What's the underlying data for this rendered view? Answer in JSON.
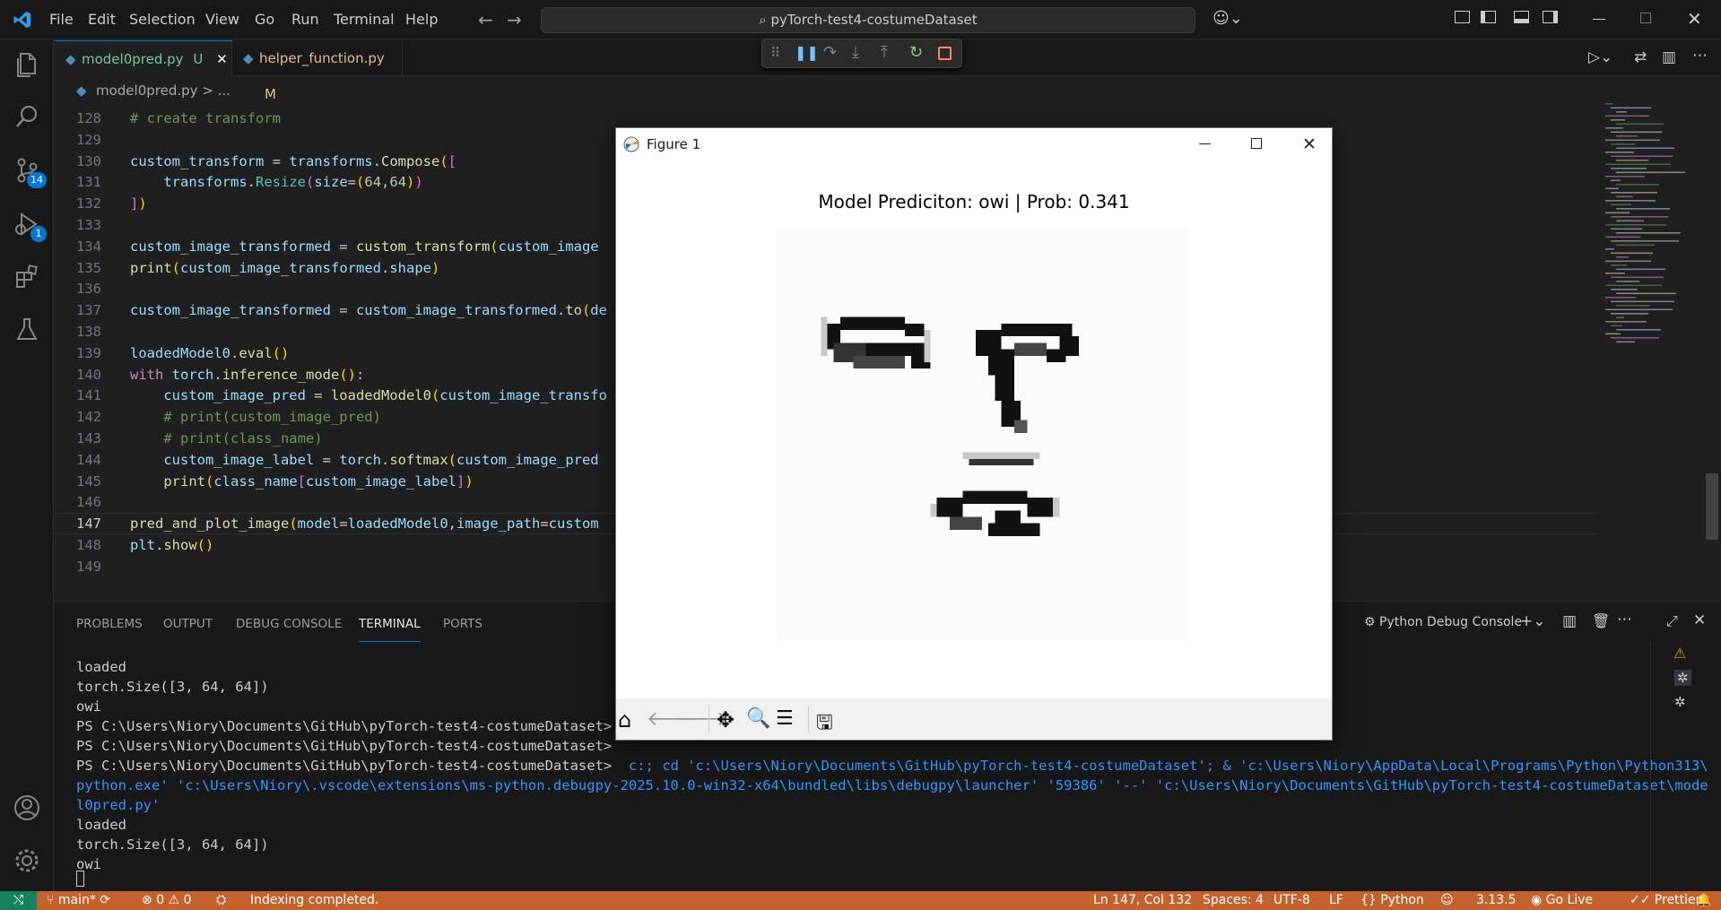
{
  "titlebar": {
    "menu": [
      "File",
      "Edit",
      "Selection",
      "View",
      "Go",
      "Run",
      "Terminal",
      "Help"
    ],
    "search_text": "pyTorch-test4-costumeDataset"
  },
  "activity": {
    "source_control_badge": "14",
    "run_debug_badge": "1"
  },
  "tabs": [
    {
      "label": "model0pred.py",
      "status": "U",
      "active": true
    },
    {
      "label": "helper_function.py",
      "status": "M",
      "active": false
    }
  ],
  "breadcrumb": {
    "file": "model0pred.py",
    "rest": "> ..."
  },
  "editor": {
    "lines": [
      {
        "n": "128",
        "html": "<span class='c'># create transform</span>"
      },
      {
        "n": "129",
        "html": ""
      },
      {
        "n": "130",
        "html": "<span class='v'>custom_transform</span> = <span class='v'>transforms</span>.<span class='f'>Compose</span><span class='b'>(</span><span class='p'>[</span>"
      },
      {
        "n": "131",
        "html": "    <span class='v'>transforms</span>.<span class='t'>Resize</span><span class='p'>(</span><span class='v'>size</span>=<span class='b'>(</span><span class='n'>64</span>,<span class='n'>64</span><span class='b'>)</span><span class='p'>)</span>"
      },
      {
        "n": "132",
        "html": "<span class='p'>]</span><span class='b'>)</span>"
      },
      {
        "n": "133",
        "html": ""
      },
      {
        "n": "134",
        "html": "<span class='v'>custom_image_transformed</span> = <span class='f'>custom_transform</span><span class='b'>(</span><span class='v'>custom_image</span>"
      },
      {
        "n": "135",
        "html": "<span class='f'>print</span><span class='b'>(</span><span class='v'>custom_image_transformed</span>.<span class='v'>shape</span><span class='b'>)</span>"
      },
      {
        "n": "136",
        "html": ""
      },
      {
        "n": "137",
        "html": "<span class='v'>custom_image_transformed</span> = <span class='v'>custom_image_transformed</span>.<span class='f'>to</span><span class='b'>(</span><span class='v'>de</span>"
      },
      {
        "n": "138",
        "html": ""
      },
      {
        "n": "139",
        "html": "<span class='v'>loadedModel0</span>.<span class='f'>eval</span><span class='b'>()</span>"
      },
      {
        "n": "140",
        "html": "<span class='k'>with</span> <span class='v'>torch</span>.<span class='f'>inference_mode</span><span class='b'>()</span>:"
      },
      {
        "n": "141",
        "html": "    <span class='v'>custom_image_pred</span> = <span class='f'>loadedModel0</span><span class='b'>(</span><span class='v'>custom_image_transfo</span>"
      },
      {
        "n": "142",
        "html": "    <span class='c'># print(custom_image_pred)</span>"
      },
      {
        "n": "143",
        "html": "    <span class='c'># print(class_name)</span>"
      },
      {
        "n": "144",
        "html": "    <span class='v'>custom_image_label</span> = <span class='v'>torch</span>.<span class='f'>softmax</span><span class='b'>(</span><span class='v'>custom_image_pred</span>"
      },
      {
        "n": "145",
        "html": "    <span class='f'>print</span><span class='b'>(</span><span class='v'>class_name</span><span class='p'>[</span><span class='v'>custom_image_label</span><span class='p'>]</span><span class='b'>)</span>"
      },
      {
        "n": "146",
        "html": ""
      },
      {
        "n": "147",
        "html": "<span class='f'>pred_and_plot_image</span><span class='b'>(</span><span class='v'>model</span>=<span class='v'>loadedModel0</span>,<span class='v'>image_path</span>=<span class='v'>custom</span>"
      },
      {
        "n": "148",
        "html": "<span class='v'>plt</span>.<span class='f'>show</span><span class='b'>()</span>"
      },
      {
        "n": "149",
        "html": ""
      }
    ]
  },
  "panel": {
    "tabs": [
      "PROBLEMS",
      "OUTPUT",
      "DEBUG CONSOLE",
      "TERMINAL",
      "PORTS"
    ],
    "active_tab": "TERMINAL",
    "console_name": "Python Debug Console",
    "terminal_lines": [
      "loaded",
      "torch.Size([3, 64, 64])",
      "owi",
      "PS C:\\Users\\Niory\\Documents\\GitHub\\pyTorch-test4-costumeDataset> ^C",
      "PS C:\\Users\\Niory\\Documents\\GitHub\\pyTorch-test4-costumeDataset>",
      "PS C:\\Users\\Niory\\Documents\\GitHub\\pyTorch-test4-costumeDataset>  c:; cd 'c:\\Users\\Niory\\Documents\\GitHub\\pyTorch-test4-costumeDataset'; & 'c:\\Users\\Niory\\AppData\\Local\\Programs\\Python\\Python313\\",
      "python.exe' 'c:\\Users\\Niory\\.vscode\\extensions\\ms-python.debugpy-2025.10.0-win32-x64\\bundled\\libs\\debugpy\\launcher' '59386' '--' 'c:\\Users\\Niory\\Documents\\GitHub\\pyTorch-test4-costumeDataset\\mode",
      "l0pred.py'",
      "loaded",
      "torch.Size([3, 64, 64])",
      "owi"
    ]
  },
  "statusbar": {
    "branch": "main*",
    "errors": "0",
    "warnings": "0",
    "indexing": "Indexing completed.",
    "position": "Ln 147, Col 132",
    "spaces": "Spaces: 4",
    "encoding": "UTF-8",
    "eol": "LF",
    "language": "Python",
    "python_version": "3.13.5",
    "go_live": "Go Live",
    "prettier": "Prettier"
  },
  "figure": {
    "window_title": "Figure 1",
    "plot_title": "Model Prediciton: owi | Prob: 0.341"
  },
  "colors": {
    "accent": "#0078d4",
    "statusbar": "#c4622d",
    "editor_bg": "#1f1f1f"
  }
}
